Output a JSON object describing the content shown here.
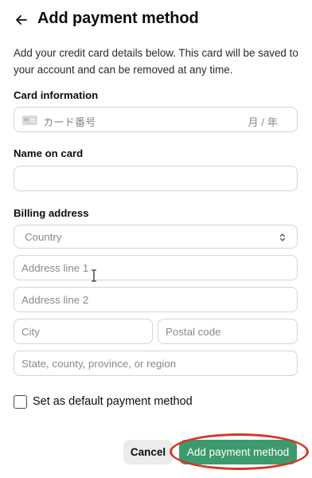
{
  "header": {
    "back_icon": "arrow-left-icon",
    "title": "Add payment method"
  },
  "description": "Add your credit card details below. This card will be saved to your account and can be removed at any time.",
  "card_section": {
    "label": "Card information",
    "card_icon": "credit-card-icon",
    "number_placeholder": "カード番号",
    "expiry_placeholder": "月 / 年"
  },
  "name_section": {
    "label": "Name on card",
    "value": ""
  },
  "billing_section": {
    "label": "Billing address",
    "country_placeholder": "Country",
    "country_icon": "chevron-up-down-icon",
    "address_line1_placeholder": "Address line 1",
    "address_line2_placeholder": "Address line 2",
    "city_placeholder": "City",
    "postal_placeholder": "Postal code",
    "state_placeholder": "State, county, province, or region"
  },
  "default_option": {
    "label": "Set as default payment method",
    "checked": false
  },
  "actions": {
    "cancel_label": "Cancel",
    "submit_label": "Add payment method",
    "submit_color": "#3d9a6e",
    "highlight_color": "#d6372a"
  }
}
